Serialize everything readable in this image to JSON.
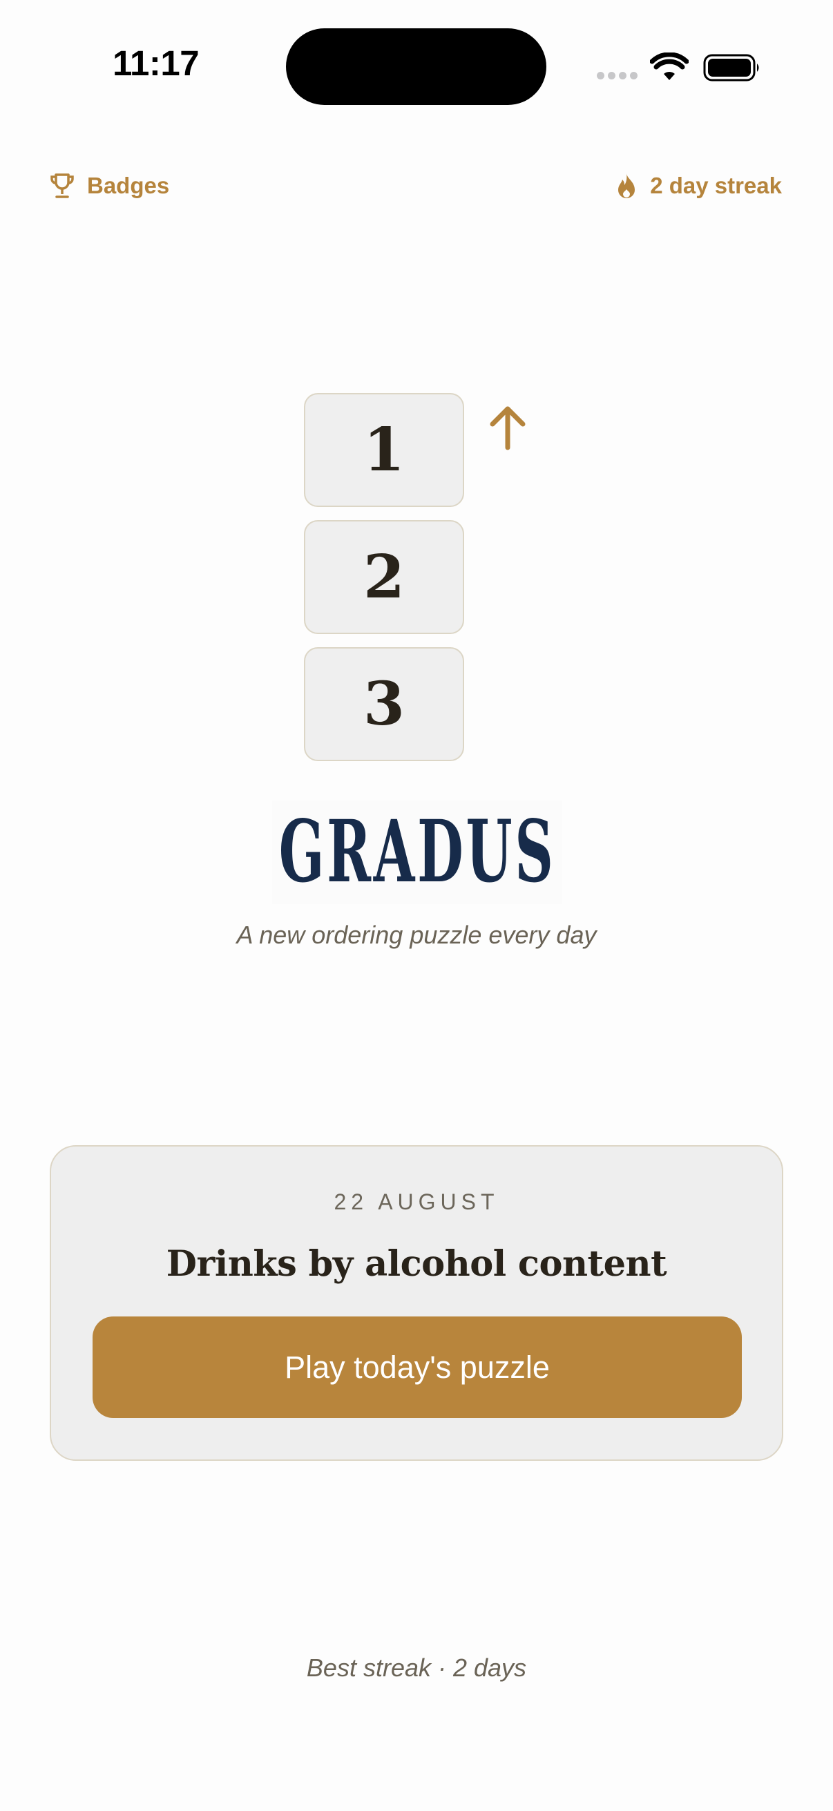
{
  "status_bar": {
    "time": "11:17",
    "icons": [
      "cellular-signal-icon",
      "wifi-icon",
      "battery-icon"
    ]
  },
  "top_bar": {
    "badges": {
      "icon": "trophy-icon",
      "label": "Badges"
    },
    "streak": {
      "icon": "flame-icon",
      "label": "2 day streak"
    }
  },
  "hero": {
    "tiles": [
      "1",
      "2",
      "3"
    ],
    "arrow_icon": "arrow-up-icon",
    "logo_text": "GRADUS",
    "tagline": "A new ordering puzzle every day"
  },
  "puzzle_card": {
    "date": "22 AUGUST",
    "title": "Drinks by alcohol content",
    "play_label": "Play today's puzzle"
  },
  "footer": {
    "best_streak": "Best streak · 2 days"
  },
  "colors": {
    "accent": "#b8853c",
    "logo": "#172b4a",
    "text_dark": "#29231a",
    "text_muted": "#6a6356",
    "card_bg": "#eeeeee",
    "card_border": "#ddd6c6",
    "page_bg": "#fdfdfd"
  }
}
